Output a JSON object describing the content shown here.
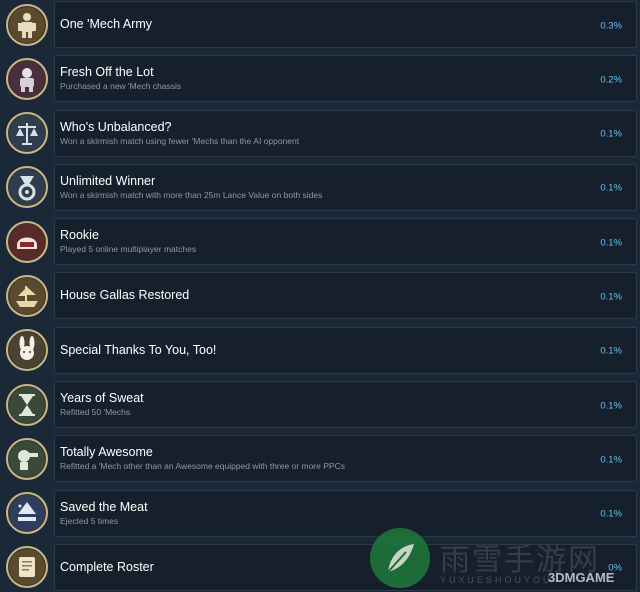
{
  "achievements": [
    {
      "title": "One 'Mech Army",
      "desc": "",
      "pct": "0.3%",
      "icon": "mech-figure-icon",
      "bg": "#5a4a2e"
    },
    {
      "title": "Fresh Off the Lot",
      "desc": "Purchased a new 'Mech chassis",
      "pct": "0.2%",
      "icon": "mech-chassis-icon",
      "bg": "#4a2e3e"
    },
    {
      "title": "Who's Unbalanced?",
      "desc": "Won a skirmish match using fewer 'Mechs than the AI opponent",
      "pct": "0.1%",
      "icon": "scales-icon",
      "bg": "#2e3e4e"
    },
    {
      "title": "Unlimited Winner",
      "desc": "Won a skirmish match with more than 25m Lance Value on both sides",
      "pct": "0.1%",
      "icon": "medal-icon",
      "bg": "#2e3e4e"
    },
    {
      "title": "Rookie",
      "desc": "Played 5 online multiplayer matches",
      "pct": "0.1%",
      "icon": "helmet-icon",
      "bg": "#5a2a2a"
    },
    {
      "title": "House Gallas Restored",
      "desc": "",
      "pct": "0.1%",
      "icon": "ship-icon",
      "bg": "#5a4a2e"
    },
    {
      "title": "Special Thanks To You, Too!",
      "desc": "",
      "pct": "0.1%",
      "icon": "rabbit-icon",
      "bg": "#4a4232"
    },
    {
      "title": "Years of Sweat",
      "desc": "Refitted 50 'Mechs",
      "pct": "0.1%",
      "icon": "hourglass-icon",
      "bg": "#3a4a3a"
    },
    {
      "title": "Totally Awesome",
      "desc": "Refitted a 'Mech other than an Awesome equipped with three or more PPCs",
      "pct": "0.1%",
      "icon": "mech-arm-icon",
      "bg": "#3a4a3a"
    },
    {
      "title": "Saved the Meat",
      "desc": "Ejected 5 times",
      "pct": "0.1%",
      "icon": "eject-icon",
      "bg": "#2e3e5e"
    },
    {
      "title": "Complete Roster",
      "desc": "",
      "pct": "0%",
      "icon": "scroll-icon",
      "bg": "#5a4a2e"
    }
  ],
  "watermark": {
    "chinese": "雨雪手游网",
    "pinyin": "YUXUESHOUYOU",
    "brand": "3DMGAME"
  }
}
